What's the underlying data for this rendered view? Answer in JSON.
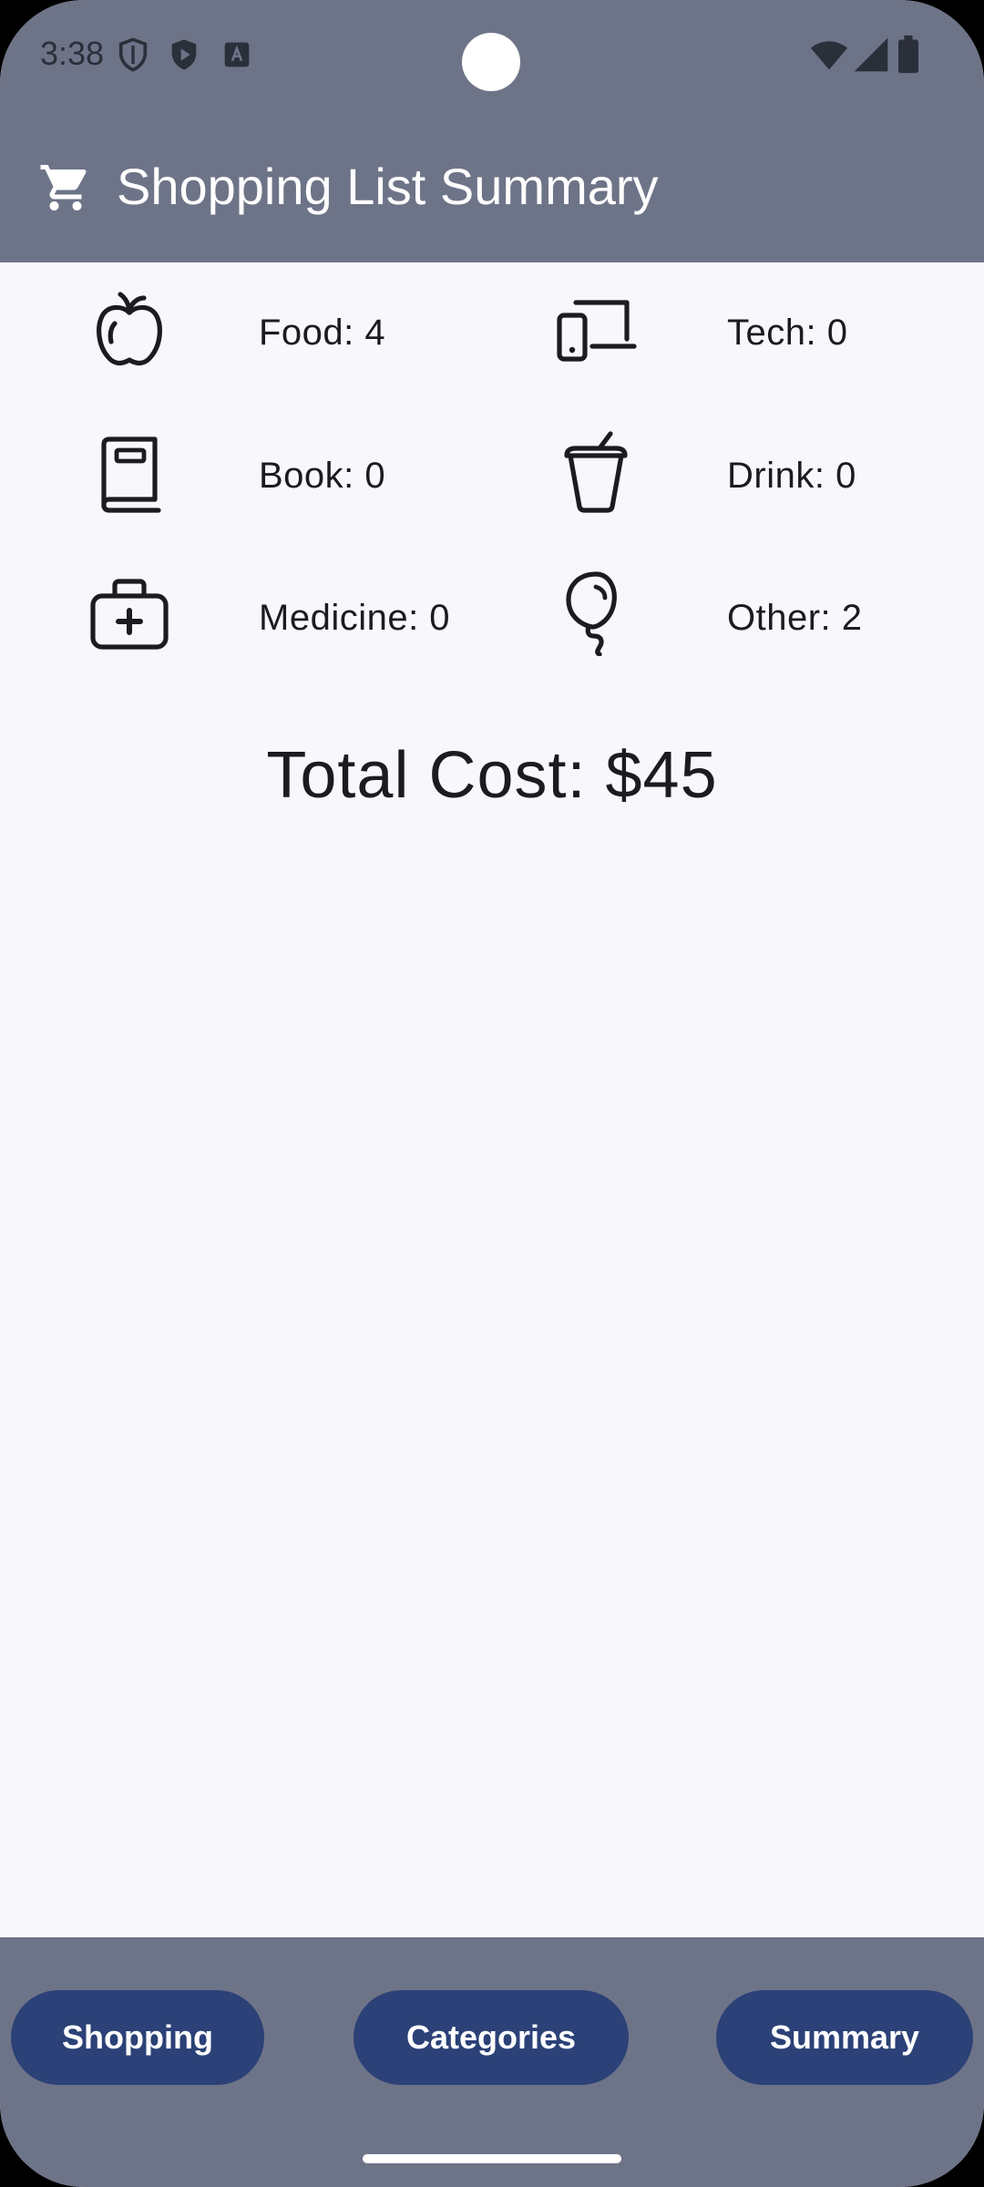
{
  "status_bar": {
    "time": "3:38",
    "left_icons": [
      "shield-outline-icon",
      "play-protect-icon",
      "keyboard-a-icon"
    ],
    "right_icons": [
      "wifi-icon",
      "cell-signal-icon",
      "battery-icon"
    ]
  },
  "app_bar": {
    "title": "Shopping List Summary",
    "icon": "cart-icon"
  },
  "categories": [
    {
      "icon": "apple-icon",
      "label": "Food: 4"
    },
    {
      "icon": "devices-icon",
      "label": "Tech: 0"
    },
    {
      "icon": "book-icon",
      "label": "Book: 0"
    },
    {
      "icon": "cup-icon",
      "label": "Drink: 0"
    },
    {
      "icon": "medical-kit-icon",
      "label": "Medicine: 0"
    },
    {
      "icon": "balloon-icon",
      "label": "Other: 2"
    }
  ],
  "summary": {
    "total_cost": "Total Cost: $45"
  },
  "bottom_nav": {
    "shopping_label": "Shopping",
    "categories_label": "Categories",
    "summary_label": "Summary"
  },
  "colors": {
    "bar": "#6e7488",
    "nav_button": "#2b4177",
    "background": "#f8f7fc",
    "text": "#1c1b1f"
  }
}
